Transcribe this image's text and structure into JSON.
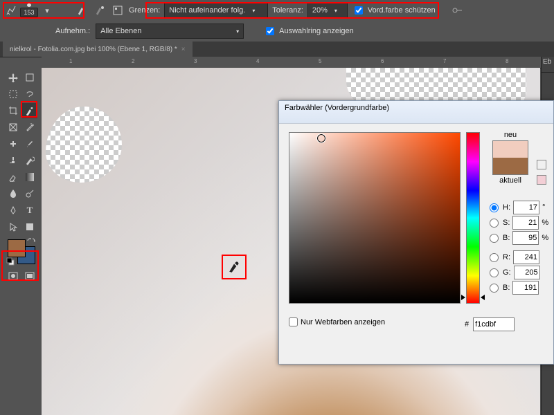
{
  "options": {
    "brush_size": "153",
    "grenzen_label": "Grenzen:",
    "grenzen_value": "Nicht aufeinander folg.",
    "toleranz_label": "Toleranz:",
    "toleranz_value": "20%",
    "protect_fg_label": "Vord.farbe schützen",
    "aufnehm_label": "Aufnehm.:",
    "aufnehm_value": "Alle Ebenen",
    "show_ring_label": "Auswahlring anzeigen"
  },
  "tab": {
    "title": "nielkrol - Fotolia.com.jpg bei 100% (Ebene 1, RGB/8) *"
  },
  "ruler": [
    "1",
    "2",
    "3",
    "4",
    "5",
    "6",
    "7",
    "8"
  ],
  "tools": {
    "fg_color": "#9c6a44",
    "bg_color": "#335a88"
  },
  "dialog": {
    "title": "Farbwähler (Vordergrundfarbe)",
    "new_label": "neu",
    "current_label": "aktuell",
    "new_color": "#f1cdbf",
    "old_color": "#9c6a44",
    "hsb": {
      "H": "17",
      "S": "21",
      "B": "95"
    },
    "rgb": {
      "R": "241",
      "G": "205",
      "B": "191"
    },
    "hex": "f1cdbf",
    "web_only_label": "Nur Webfarben anzeigen"
  },
  "panel": {
    "tab": "Eb"
  }
}
